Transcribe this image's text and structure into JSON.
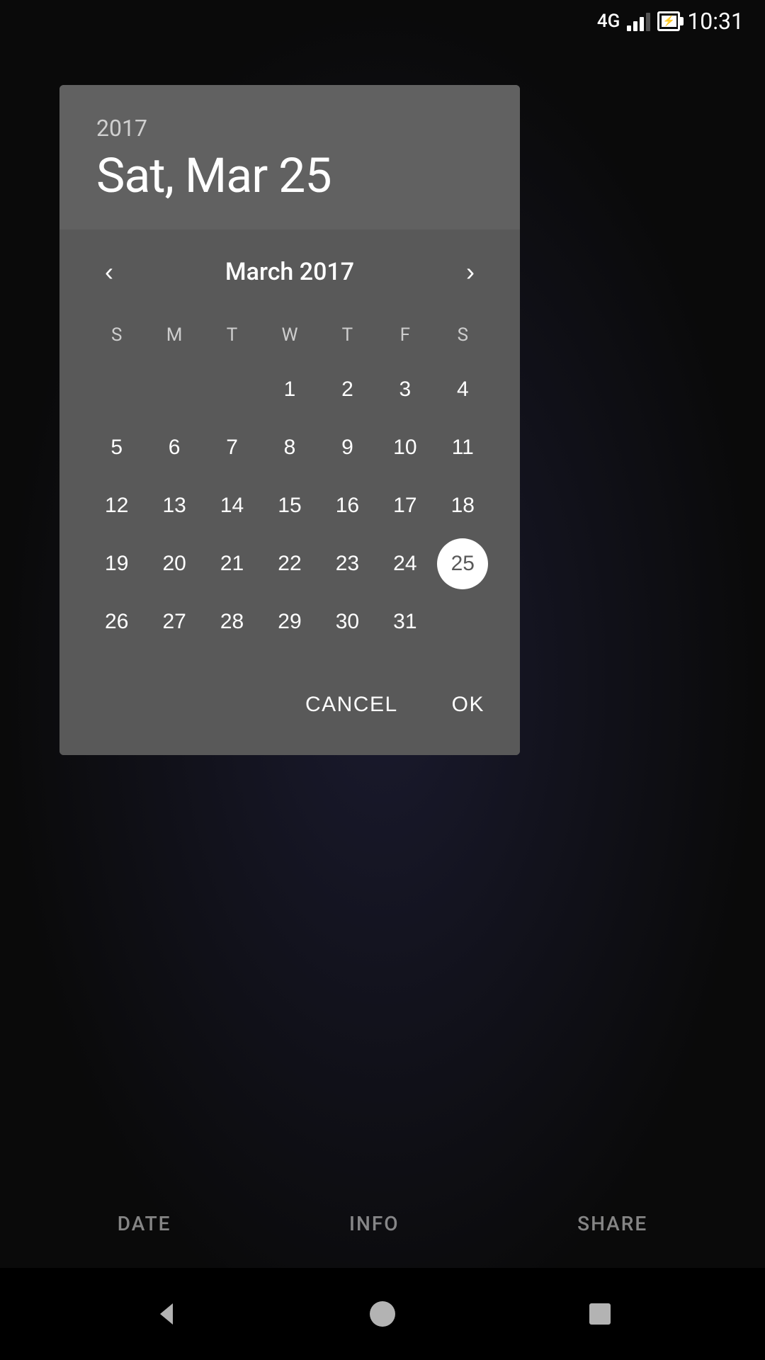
{
  "statusBar": {
    "time": "10:31",
    "networkType": "4G"
  },
  "dialog": {
    "year": "2017",
    "selectedDate": "Sat, Mar 25",
    "monthTitle": "March 2017",
    "selectedDay": 25,
    "cancelLabel": "CANCEL",
    "okLabel": "OK"
  },
  "calendar": {
    "dayHeaders": [
      "S",
      "M",
      "T",
      "W",
      "T",
      "F",
      "S"
    ],
    "weeks": [
      [
        null,
        null,
        null,
        1,
        2,
        3,
        4
      ],
      [
        5,
        6,
        7,
        8,
        9,
        10,
        11
      ],
      [
        12,
        13,
        14,
        15,
        16,
        17,
        18
      ],
      [
        19,
        20,
        21,
        22,
        23,
        24,
        25
      ],
      [
        26,
        27,
        28,
        29,
        30,
        31,
        null
      ]
    ]
  },
  "bottomTabs": {
    "items": [
      {
        "label": "DATE",
        "id": "date"
      },
      {
        "label": "INFO",
        "id": "info"
      },
      {
        "label": "SHARE",
        "id": "share"
      }
    ]
  },
  "systemNav": {
    "back": "◀",
    "home": "●",
    "recent": "■"
  }
}
